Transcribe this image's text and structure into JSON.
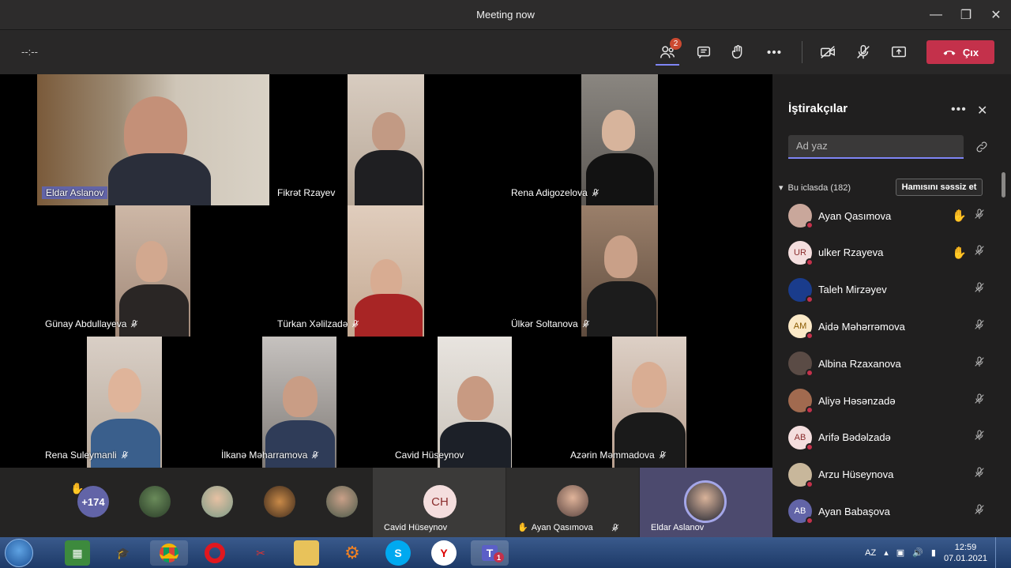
{
  "window": {
    "title": "Meeting now",
    "minimize": "—",
    "maximize": "❐",
    "close": "✕"
  },
  "toolbar": {
    "timer": "--:--",
    "participants_badge": "2",
    "leave_label": "Çıx"
  },
  "stage": {
    "tiles": [
      {
        "name": "Eldar  Aslanov",
        "muted": false,
        "highlight": true
      },
      {
        "name": "Fikrət Rzayev",
        "muted": false
      },
      {
        "name": "Rena Adigozelova",
        "muted": true
      },
      {
        "name": "Günay Abdullayeva",
        "muted": true
      },
      {
        "name": "Türkan Xəlilzadə",
        "muted": true
      },
      {
        "name": "Ülkər Soltanova",
        "muted": true
      },
      {
        "name": "Rena Suleymanli",
        "muted": true
      },
      {
        "name": "İlkanə Məharramova",
        "muted": true
      },
      {
        "name": "Cavid Hüseynov",
        "muted": false
      },
      {
        "name": "Azərin Məmmadova",
        "muted": true
      }
    ]
  },
  "strip": {
    "overflow_count": "+174",
    "tile1_initials": "CH",
    "tile1_name": "Cavid Hüseynov",
    "tile2_name": "Ayan Qasımova",
    "tile3_name": "Eldar Aslanov"
  },
  "panel": {
    "title": "İştirakçılar",
    "more": "•••",
    "close": "✕",
    "search_placeholder": "Ad yaz",
    "section_label": "Bu iclasda (182)",
    "mute_all": "Hamısını səssiz et",
    "participants": [
      {
        "name": "Ayan Qasımova",
        "initials": "",
        "hand": true,
        "avatar_color": "#c9a79b"
      },
      {
        "name": "ulker Rzayeva",
        "initials": "UR",
        "hand": true,
        "avatar_color": "#f4dede"
      },
      {
        "name": "Taleh Mirzəyev",
        "initials": "",
        "hand": false,
        "avatar_color": "#1a3c8c"
      },
      {
        "name": "Aidə Məhərrəmova",
        "initials": "AM",
        "hand": false,
        "avatar_color": "#fbe9c7"
      },
      {
        "name": "Albina Rzaxanova",
        "initials": "",
        "hand": false,
        "avatar_color": "#5a4b45"
      },
      {
        "name": "Aliyə Həsənzadə",
        "initials": "",
        "hand": false,
        "avatar_color": "#a16a4f"
      },
      {
        "name": "Arifə Bədəlzadə",
        "initials": "AB",
        "hand": false,
        "avatar_color": "#f4dede"
      },
      {
        "name": "Arzu Hüseynova",
        "initials": "",
        "hand": false,
        "avatar_color": "#c8b79b"
      },
      {
        "name": "Ayan Babaşova",
        "initials": "AB",
        "hand": false,
        "avatar_color": "#6264a7"
      }
    ]
  },
  "taskbar": {
    "lang": "AZ",
    "time": "12:59",
    "date": "07.01.2021",
    "teams_badge": "1"
  }
}
